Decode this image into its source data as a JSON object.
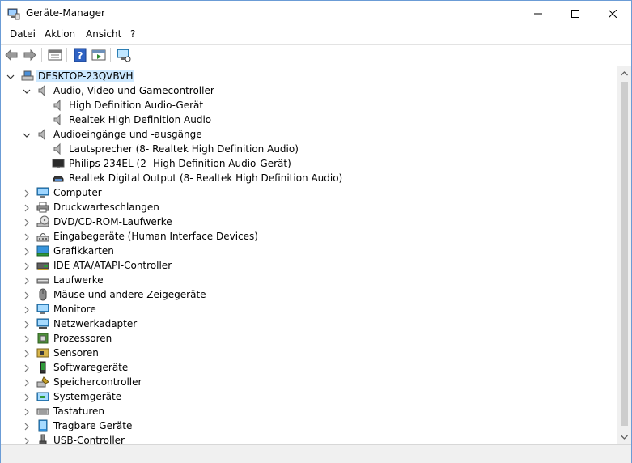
{
  "window": {
    "title": "Geräte-Manager"
  },
  "menu": [
    "Datei",
    "Aktion",
    "Ansicht",
    "?"
  ],
  "tree": {
    "root": "DESKTOP-23QVBVH",
    "rows": [
      {
        "label": "Audio, Video und Gamecontroller",
        "state": "expanded",
        "icon": "speaker-icon"
      },
      {
        "label": "High Definition Audio-Gerät",
        "state": "leaf",
        "icon": "speaker-icon"
      },
      {
        "label": "Realtek High Definition Audio",
        "state": "leaf",
        "icon": "speaker-icon"
      },
      {
        "label": "Audioeingänge und -ausgänge",
        "state": "expanded",
        "icon": "speaker-icon"
      },
      {
        "label": "Lautsprecher (8- Realtek High Definition Audio)",
        "state": "leaf",
        "icon": "speaker-icon"
      },
      {
        "label": "Philips 234EL (2- High Definition Audio-Gerät)",
        "state": "leaf",
        "icon": "display-icon"
      },
      {
        "label": "Realtek Digital Output (8- Realtek High Definition Audio)",
        "state": "leaf",
        "icon": "digital-output-icon"
      },
      {
        "label": "Computer",
        "state": "collapsed",
        "icon": "computer-icon"
      },
      {
        "label": "Druckwarteschlangen",
        "state": "collapsed",
        "icon": "printer-icon"
      },
      {
        "label": "DVD/CD-ROM-Laufwerke",
        "state": "collapsed",
        "icon": "dvd-drive-icon"
      },
      {
        "label": "Eingabegeräte (Human Interface Devices)",
        "state": "collapsed",
        "icon": "hid-icon"
      },
      {
        "label": "Grafikkarten",
        "state": "collapsed",
        "icon": "display-adapter-icon"
      },
      {
        "label": "IDE ATA/ATAPI-Controller",
        "state": "collapsed",
        "icon": "ide-controller-icon"
      },
      {
        "label": "Laufwerke",
        "state": "collapsed",
        "icon": "disk-drive-icon"
      },
      {
        "label": "Mäuse und andere Zeigegeräte",
        "state": "collapsed",
        "icon": "mouse-icon"
      },
      {
        "label": "Monitore",
        "state": "collapsed",
        "icon": "monitor-icon"
      },
      {
        "label": "Netzwerkadapter",
        "state": "collapsed",
        "icon": "network-adapter-icon"
      },
      {
        "label": "Prozessoren",
        "state": "collapsed",
        "icon": "processor-icon"
      },
      {
        "label": "Sensoren",
        "state": "collapsed",
        "icon": "sensor-icon"
      },
      {
        "label": "Softwaregeräte",
        "state": "collapsed",
        "icon": "software-device-icon"
      },
      {
        "label": "Speichercontroller",
        "state": "collapsed",
        "icon": "storage-controller-icon"
      },
      {
        "label": "Systemgeräte",
        "state": "collapsed",
        "icon": "system-device-icon"
      },
      {
        "label": "Tastaturen",
        "state": "collapsed",
        "icon": "keyboard-icon"
      },
      {
        "label": "Tragbare Geräte",
        "state": "collapsed",
        "icon": "portable-device-icon"
      },
      {
        "label": "USB-Controller",
        "state": "collapsed",
        "icon": "usb-controller-icon"
      }
    ]
  },
  "colors": {
    "selection": "#cce8ff",
    "window_border": "#6b9cd6"
  }
}
